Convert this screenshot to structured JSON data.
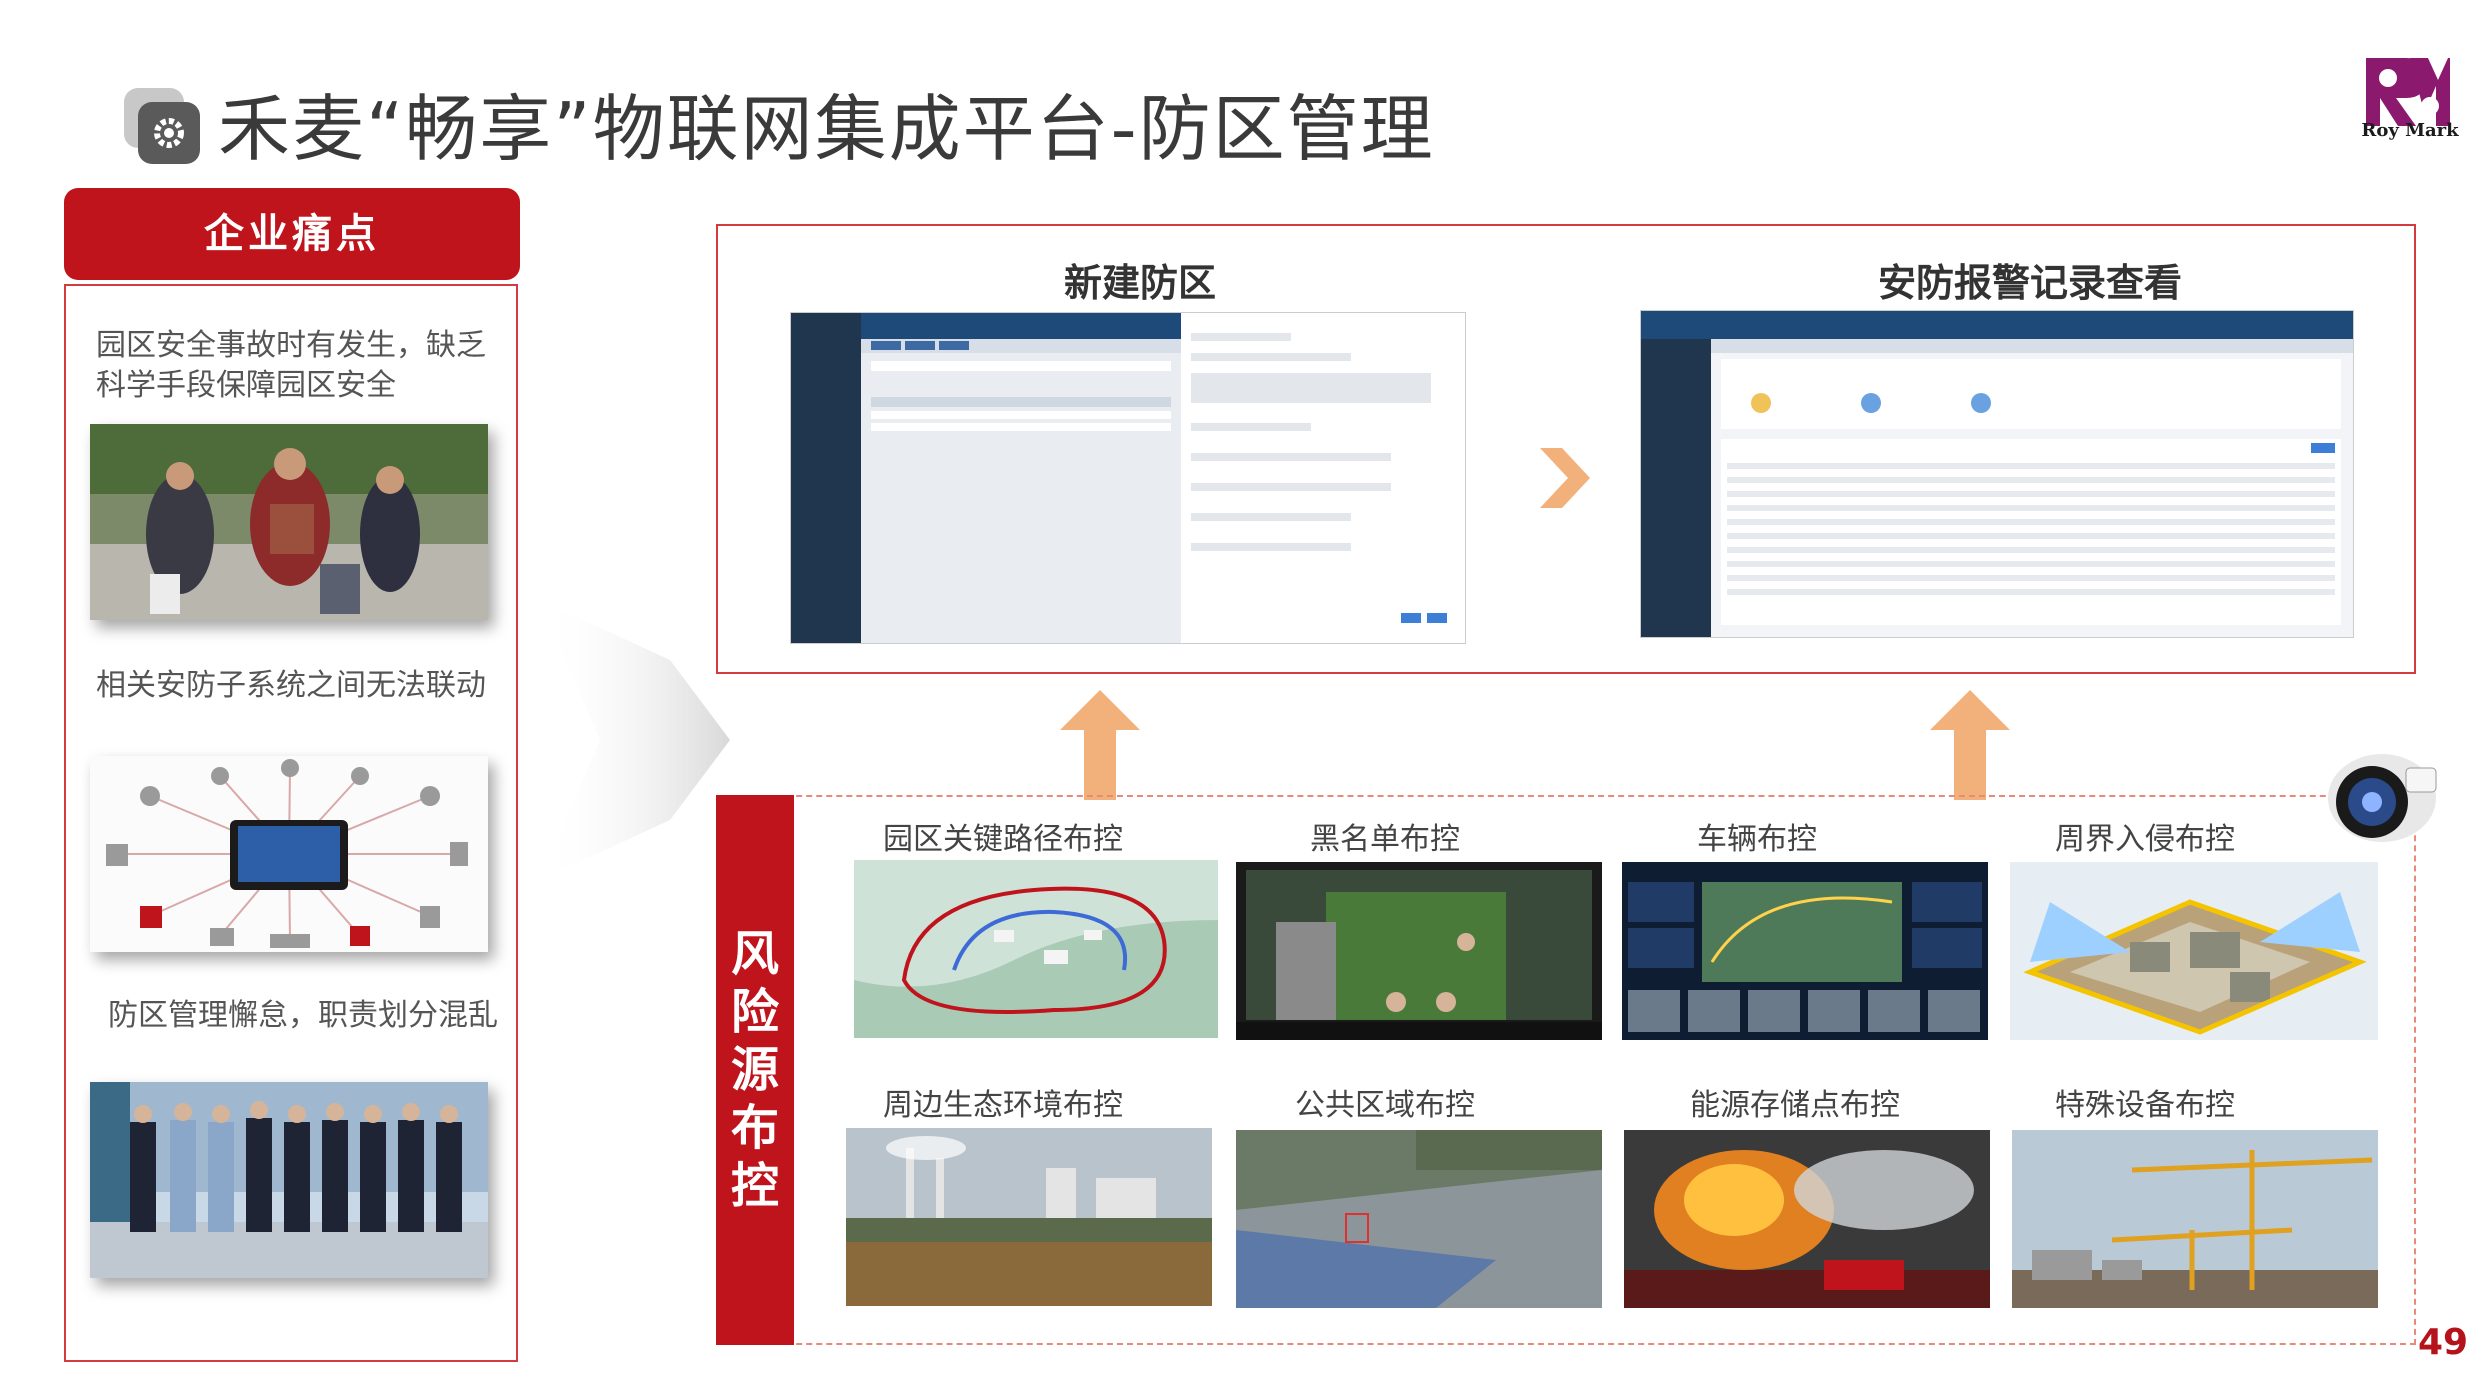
{
  "header": {
    "title": "禾麦“畅享”物联网集成平台-防区管理",
    "logo_text": "Roy Mark",
    "icon": "gear-icon"
  },
  "pain_points": {
    "heading": "企业痛点",
    "items": [
      {
        "text_line1": "园区安全事故时有发生，缺乏",
        "text_line2": "科学手段保障园区安全"
      },
      {
        "text_line1": "相关安防子系统之间无法联动",
        "text_line2": ""
      },
      {
        "text_line1": "防区管理懈怠，职责划分混乱",
        "text_line2": ""
      }
    ]
  },
  "top_section": {
    "left_title": "新建防区",
    "right_title": "安防报警记录查看"
  },
  "risk_section": {
    "label_chars": [
      "风",
      "险",
      "源",
      "布",
      "控"
    ],
    "tiles": [
      {
        "label": "园区关键路径布控"
      },
      {
        "label": "黑名单布控"
      },
      {
        "label": "车辆布控"
      },
      {
        "label": "周界入侵布控"
      },
      {
        "label": "周边生态环境布控"
      },
      {
        "label": "公共区域布控"
      },
      {
        "label": "能源存储点布控"
      },
      {
        "label": "特殊设备布控"
      }
    ]
  },
  "footer": {
    "page_number": "49"
  },
  "colors": {
    "brand_red": "#c0141d",
    "accent_orange": "#f0a060",
    "logo_purple": "#8b1a6e"
  }
}
